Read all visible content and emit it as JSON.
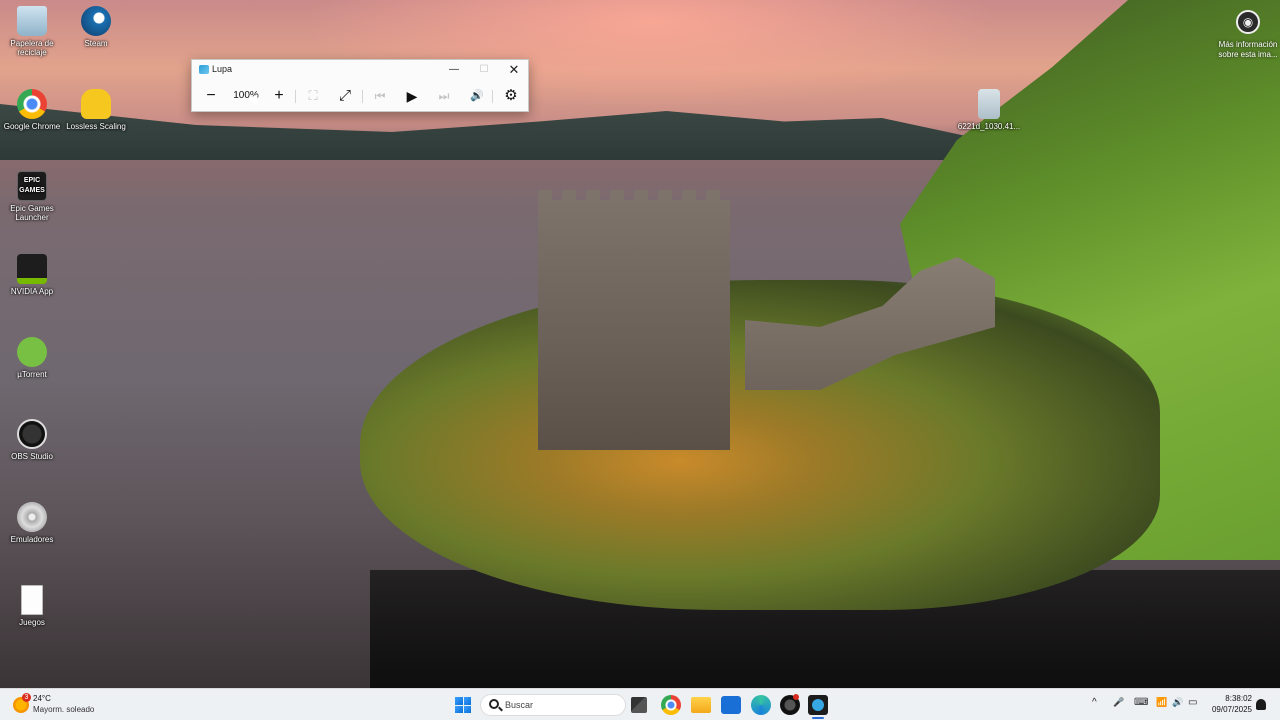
{
  "desktop": {
    "icons": [
      {
        "label": "Papelera de reciclaje",
        "icon": "recycle-bin-icon"
      },
      {
        "label": "Steam",
        "icon": "steam-icon"
      },
      {
        "label": "Google Chrome",
        "icon": "chrome-icon"
      },
      {
        "label": "Lossless Scaling",
        "icon": "lossless-scaling-icon"
      },
      {
        "label": "Epic Games Launcher",
        "icon": "epic-games-icon"
      },
      {
        "label": "NVIDIA App",
        "icon": "nvidia-icon"
      },
      {
        "label": "µTorrent",
        "icon": "utorrent-icon"
      },
      {
        "label": "OBS Studio",
        "icon": "obs-icon"
      },
      {
        "label": "Emuladores",
        "icon": "disc-icon"
      },
      {
        "label": "Juegos",
        "icon": "document-icon"
      },
      {
        "label": "6221d_1030.41...",
        "icon": "file-icon"
      }
    ],
    "info_label": "Más información sobre esta ima...",
    "epic_icon_text": "EPIC GAMES"
  },
  "magnifier": {
    "title": "Lupa",
    "zoom": "100%",
    "buttons": {
      "zoom_out": "−",
      "zoom_in": "+",
      "fit": "⛶",
      "fullscreen": "⤢",
      "prev": "⏮",
      "play": "▶",
      "next": "⏭",
      "read_from": "🔊",
      "settings": "⚙"
    },
    "window_controls": {
      "minimize": "—",
      "maximize": "☐",
      "close": "✕"
    }
  },
  "taskbar": {
    "weather": {
      "temp": "24°C",
      "desc": "Mayorm. soleado",
      "badge": "3"
    },
    "search_placeholder": "Buscar",
    "tray": {
      "chevron": "^",
      "mic": "🎤",
      "keyboard": "⌨",
      "wifi": "📶",
      "volume": "🔊",
      "battery": "▭"
    },
    "clock": {
      "time": "8:38:02",
      "date": "09/07/2025"
    }
  },
  "colors": {
    "accent": "#2a6fd8",
    "taskbar_bg": "#eef1f4"
  }
}
